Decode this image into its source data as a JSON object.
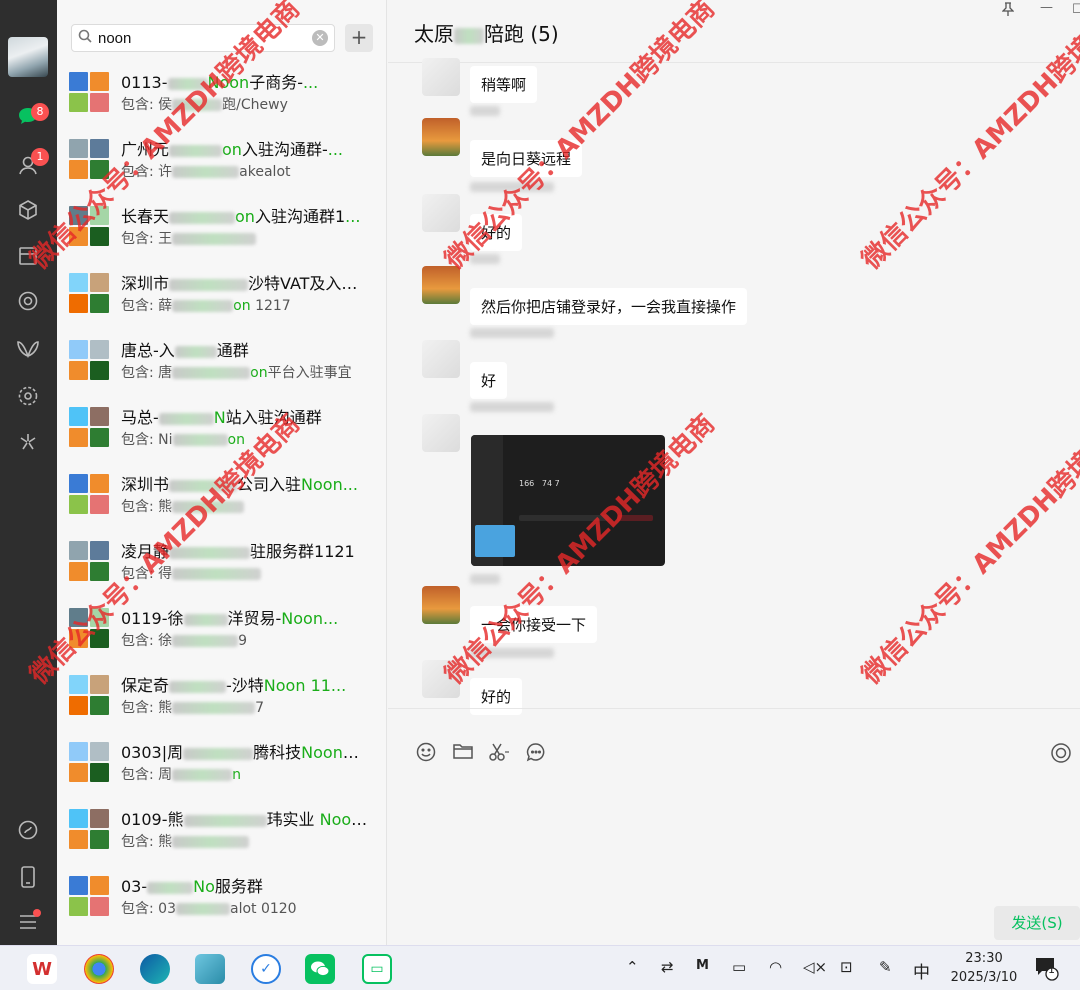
{
  "search": {
    "value": "noon"
  },
  "rail": {
    "chat_badge": "8",
    "contacts_badge": "1"
  },
  "chats": [
    {
      "pre": "0113-",
      "hl": "Noon",
      "post": "子商务-",
      "tail": "...",
      "sub_pre": "包含: 侯",
      "sub_post": "跑/Chewy",
      "sub_hl": ""
    },
    {
      "pre": "广州元",
      "hl": "on",
      "post": "入驻沟通群-",
      "tail": "...",
      "sub_pre": "包含: 许",
      "sub_post": "akealot",
      "sub_hl": ""
    },
    {
      "pre": "长春天",
      "hl": "on",
      "post": "入驻沟通群1",
      "tail": "...",
      "sub_pre": "包含: 王",
      "sub_post": "",
      "sub_hl": ""
    },
    {
      "pre": "深圳市",
      "hl": "",
      "post": "沙特VAT及入驻",
      "tail": "...",
      "sub_pre": "包含: 薛",
      "sub_post": " 1217",
      "sub_hl": "on"
    },
    {
      "pre": "唐总-入",
      "hl": "",
      "post": "通群",
      "tail": "",
      "sub_pre": "包含: 唐",
      "sub_post": "平台入驻事宜",
      "sub_hl": "on"
    },
    {
      "pre": "马总-",
      "hl": "N",
      "post": "站入驻沟通群",
      "tail": "",
      "sub_pre": "包含: Ni",
      "sub_post": "",
      "sub_hl": "on"
    },
    {
      "pre": "深圳书",
      "hl": "",
      "post": "公司入驻",
      "tail": "Noon...",
      "sub_pre": "包含: 熊",
      "sub_post": "",
      "sub_hl": ""
    },
    {
      "pre": "凌月静",
      "hl": "",
      "post": "驻服务群1121",
      "tail": "",
      "sub_pre": "包含: 得",
      "sub_post": "",
      "sub_hl": ""
    },
    {
      "pre": "0119-徐",
      "hl": "",
      "post": "洋贸易-",
      "tail": "Noon...",
      "sub_pre": "包含: 徐",
      "sub_post": "9",
      "sub_hl": ""
    },
    {
      "pre": "保定奇",
      "hl": "",
      "post": "-沙特",
      "tail": "Noon 11...",
      "sub_pre": "包含: 熊",
      "sub_post": "7",
      "sub_hl": ""
    },
    {
      "pre": "0303|周",
      "hl": "",
      "post": "腾科技",
      "tail": "Noon入...",
      "sub_pre": "包含: 周",
      "sub_post": "",
      "sub_hl": "n"
    },
    {
      "pre": "0109-熊",
      "hl": "",
      "post": "玮实业 ",
      "tail": "Noon...",
      "sub_pre": "包含: 熊",
      "sub_post": "",
      "sub_hl": ""
    },
    {
      "pre": "03-",
      "hl": "No",
      "post": "服务群",
      "tail": "",
      "sub_pre": "包含: 03",
      "sub_post": "alot 0120",
      "sub_hl": ""
    }
  ],
  "chat": {
    "title": "太原",
    "title_suffix": "陪跑 (5)",
    "messages": [
      {
        "text": "稍等啊"
      },
      {
        "text": "是向日葵远程"
      },
      {
        "text": "好的"
      },
      {
        "text": "然后你把店铺登录好，一会我直接操作"
      },
      {
        "text": "好"
      },
      {
        "text": "一会你接受一下"
      },
      {
        "text": "好的"
      }
    ],
    "screenshot_num": "166",
    "screenshot_num2": "74 7",
    "send_label": "发送(S)"
  },
  "taskbar": {
    "ime": "中",
    "time": "23:30",
    "date": "2025/3/10",
    "notif_count": "1"
  },
  "watermark": "微信公众号：AMZDH跨境电商",
  "watermark_short": "AMZDH跨境电商"
}
